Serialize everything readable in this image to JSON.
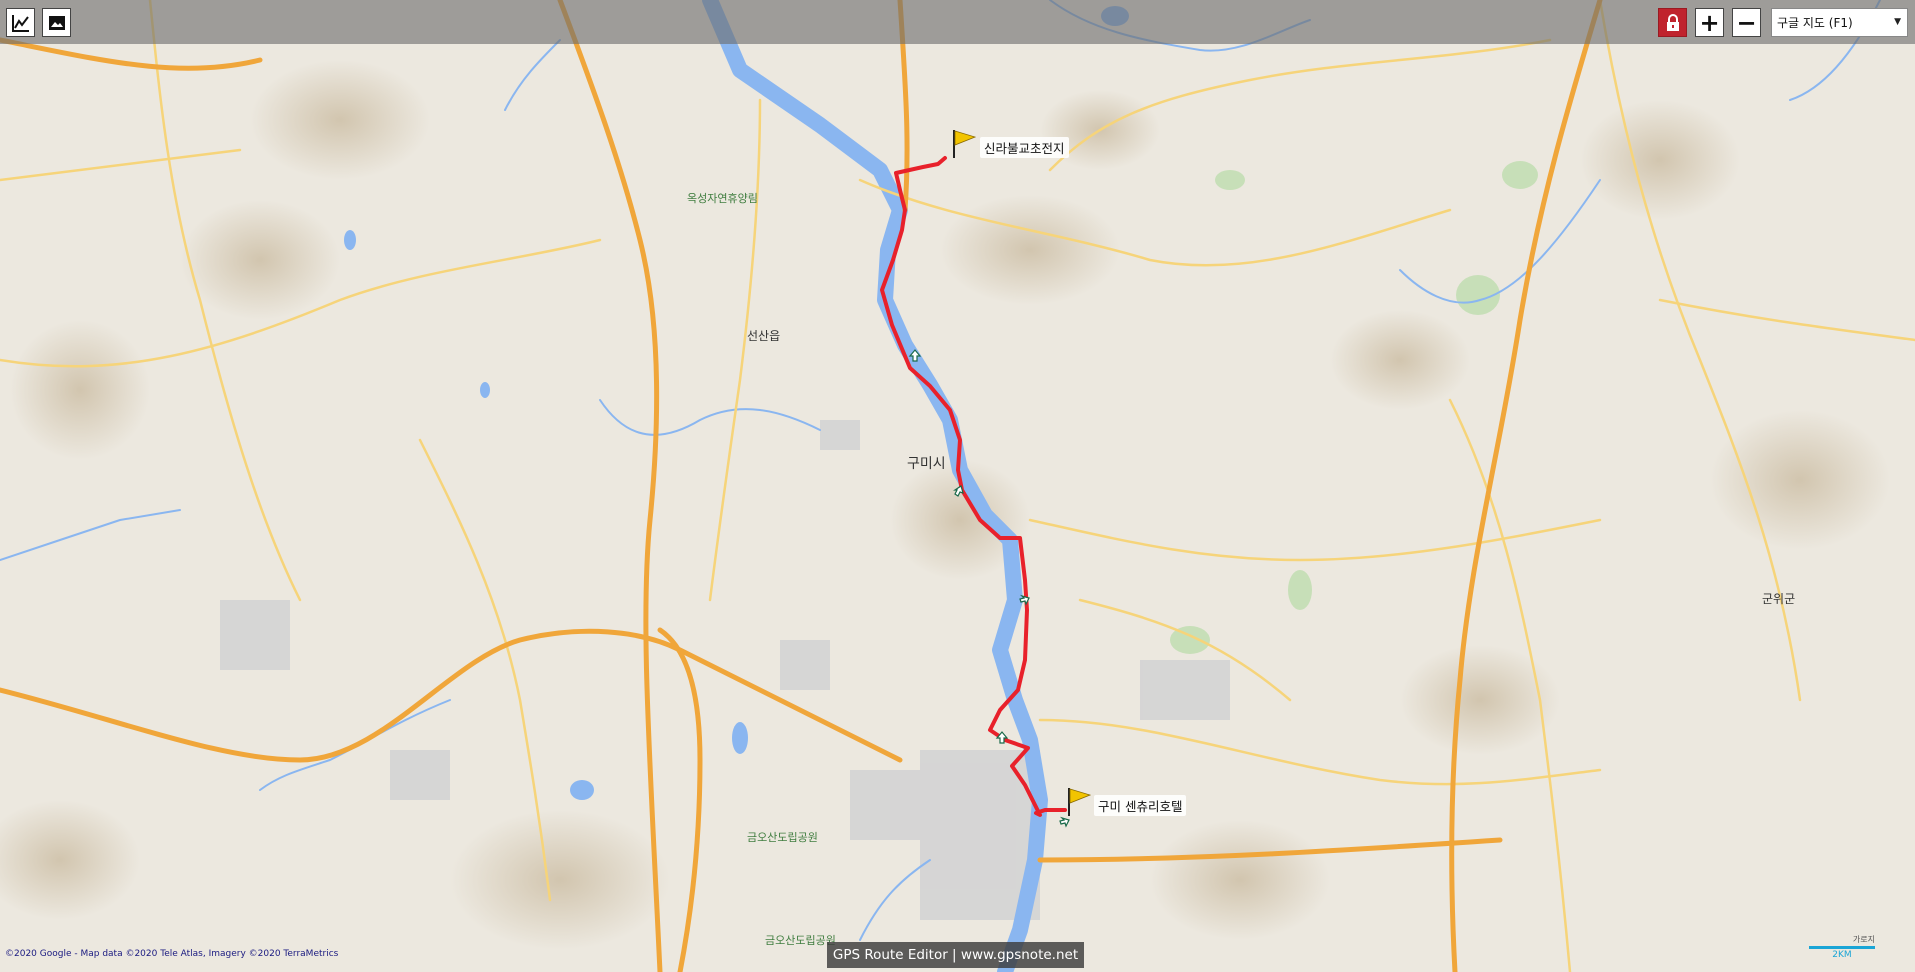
{
  "app": {
    "footer": "GPS Route Editor | www.gpsnote.net"
  },
  "toolbar": {
    "chart_icon": "line-chart-icon",
    "image_icon": "image-icon",
    "lock_icon": "lock-icon",
    "zoom_in_label": "+",
    "zoom_out_label": "−",
    "map_type_selected": "구글 지도 (F1)"
  },
  "route": {
    "color": "#e8212b",
    "start": {
      "label": "신라불교초전지"
    },
    "end": {
      "label": "구미 센츄리호텔"
    }
  },
  "map": {
    "copyright": "©2020 Google - Map data ©2020 Tele Atlas, Imagery ©2020 TerraMetrics",
    "scale": {
      "top": "가로지",
      "label": "2KM"
    },
    "colors": {
      "water": "#8ab6f0",
      "highway": "#f0a63a",
      "road": "#f6d47a",
      "urban": "#d2d2d2"
    },
    "places": {
      "gumi": "구미시",
      "sinsan": "선산읍",
      "gunwi": "군위군",
      "forest": "옥성자연휴양림",
      "park1": "금오산도립공원",
      "park2": "금오산도립공원"
    }
  }
}
